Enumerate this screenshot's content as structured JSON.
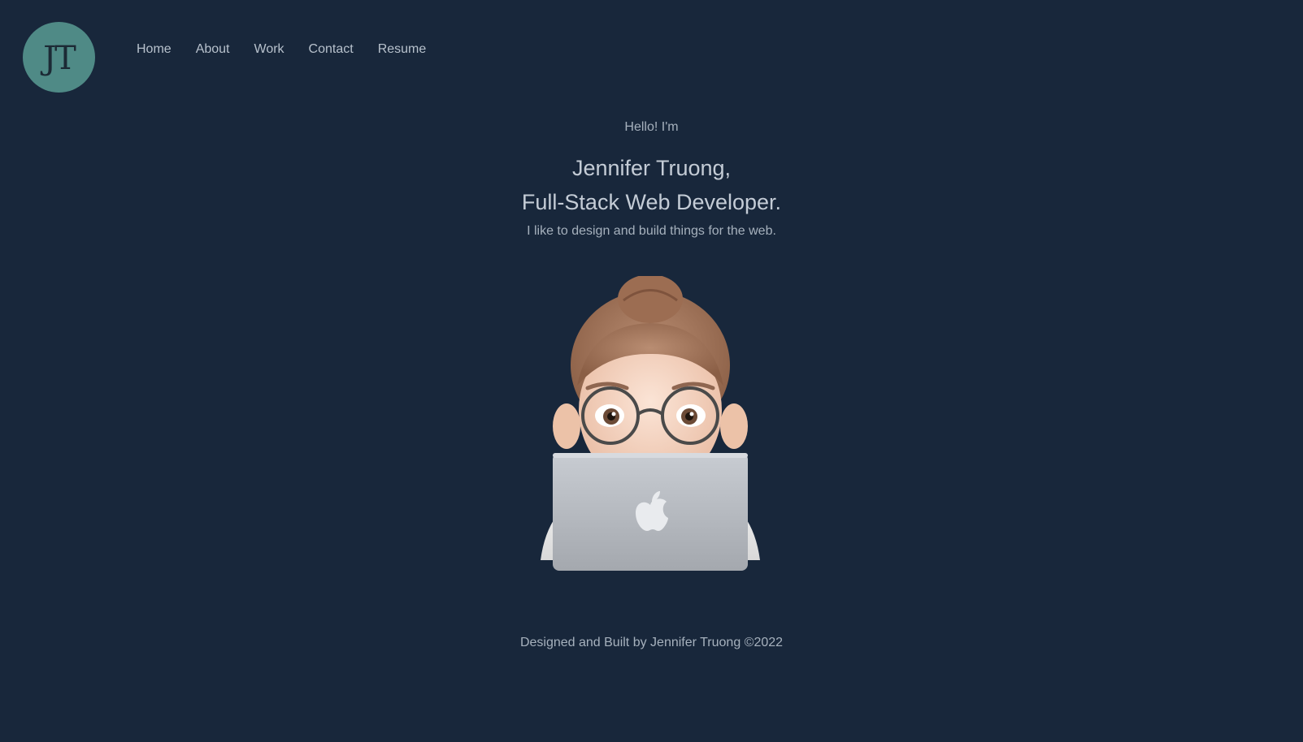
{
  "header": {
    "logo_text": "JT",
    "nav": [
      {
        "label": "Home"
      },
      {
        "label": "About"
      },
      {
        "label": "Work"
      },
      {
        "label": "Contact"
      },
      {
        "label": "Resume"
      }
    ]
  },
  "hero": {
    "greeting": "Hello! I'm",
    "name_line": "Jennifer Truong,",
    "role_line": "Full-Stack Web Developer.",
    "tagline": "I like to design and build things for the web."
  },
  "footer": {
    "text": "Designed and Built by Jennifer Truong ©2022"
  },
  "colors": {
    "background": "#18273b",
    "logo_circle": "#4f8a86",
    "text": "#c4ccd6"
  },
  "icons": {
    "avatar": "memoji-with-laptop-icon"
  }
}
